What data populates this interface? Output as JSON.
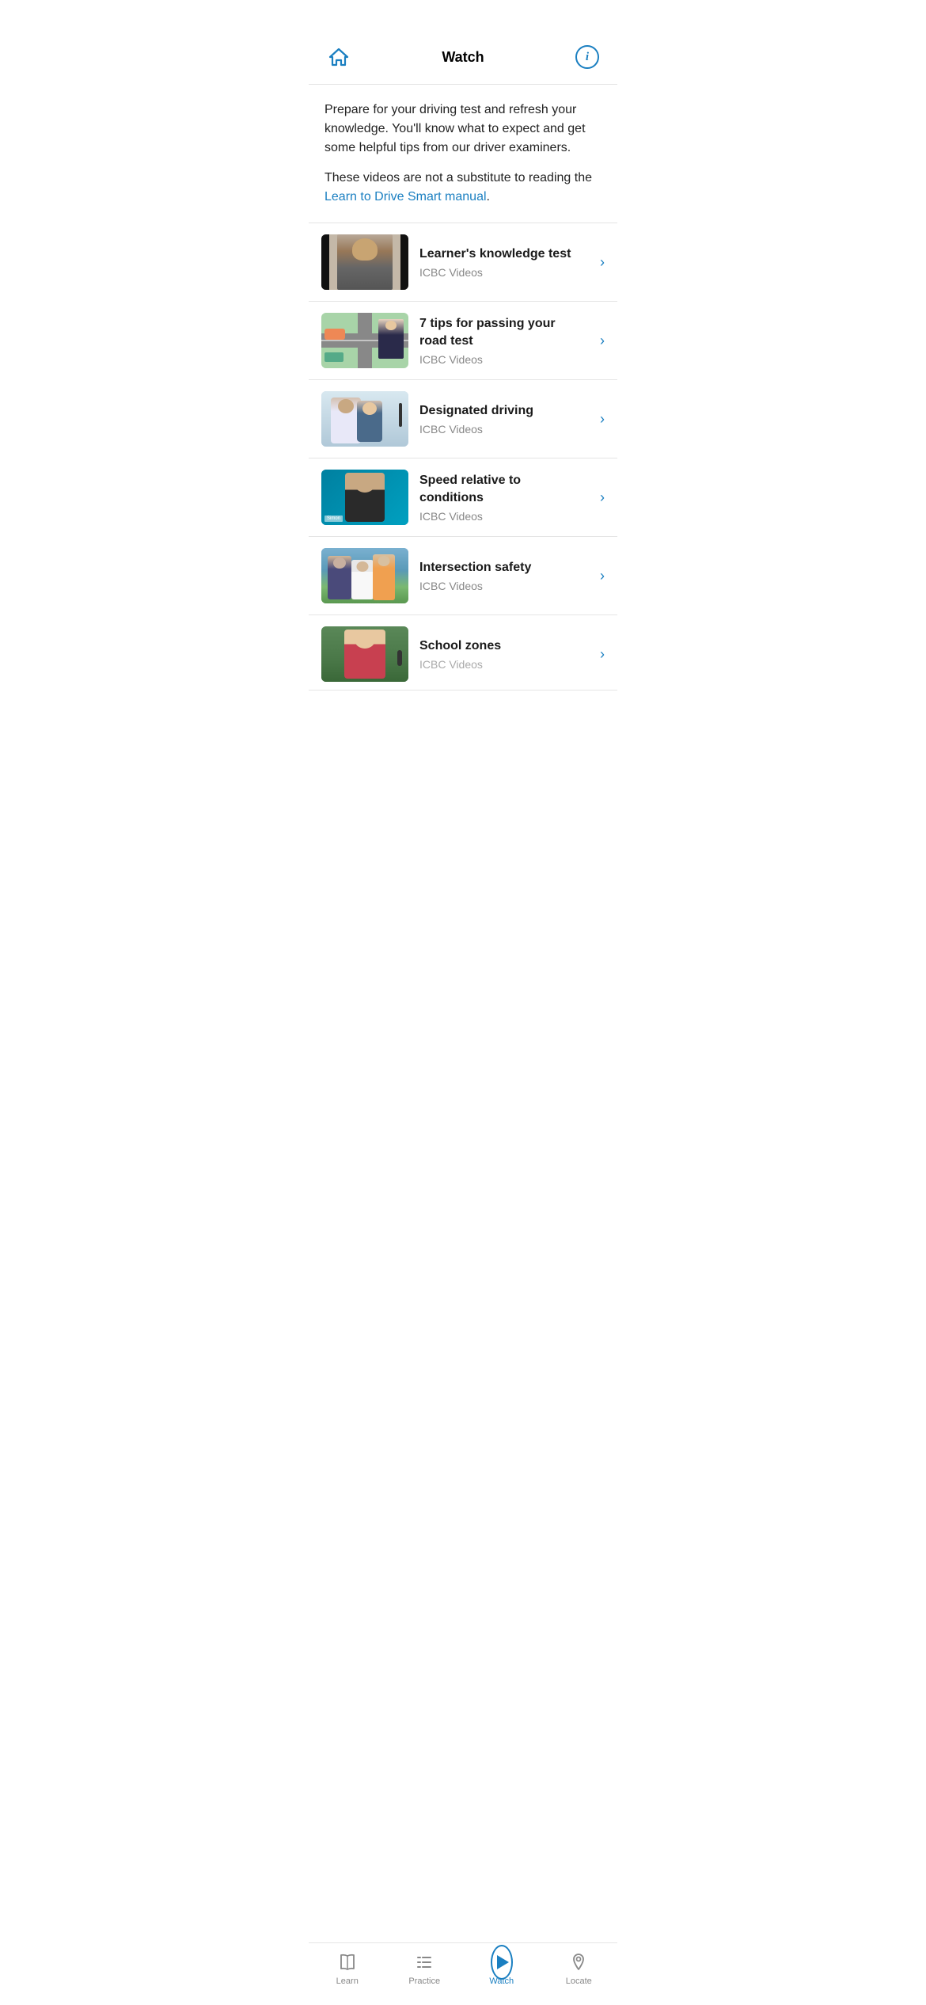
{
  "header": {
    "title": "Watch",
    "home_label": "home",
    "info_label": "info"
  },
  "intro": {
    "main_text": "Prepare for your driving test and refresh your knowledge. You'll know what to expect and get some helpful tips from our driver examiners.",
    "link_prefix": "These videos are not a substitute to reading the ",
    "link_text": "Learn to Drive Smart manual",
    "link_suffix": "."
  },
  "videos": [
    {
      "title": "Learner's knowledge test",
      "channel": "ICBC Videos",
      "thumb_type": "1"
    },
    {
      "title": "7 tips for passing your road test",
      "channel": "ICBC Videos",
      "thumb_type": "2"
    },
    {
      "title": "Designated driving",
      "channel": "ICBC Videos",
      "thumb_type": "3"
    },
    {
      "title": "Speed relative to conditions",
      "channel": "ICBC Videos",
      "thumb_type": "4"
    },
    {
      "title": "Intersection safety",
      "channel": "ICBC Videos",
      "thumb_type": "5"
    },
    {
      "title": "School zones",
      "channel": "ICBC Videos",
      "thumb_type": "6"
    }
  ],
  "bottom_nav": {
    "items": [
      {
        "label": "Learn",
        "icon": "book-icon",
        "active": false
      },
      {
        "label": "Practice",
        "icon": "list-icon",
        "active": false
      },
      {
        "label": "Watch",
        "icon": "play-icon",
        "active": true
      },
      {
        "label": "Locate",
        "icon": "location-icon",
        "active": false
      }
    ]
  },
  "colors": {
    "accent": "#1a7fc1",
    "text_primary": "#1a1a1a",
    "text_secondary": "#888888",
    "divider": "#e5e5e5"
  }
}
